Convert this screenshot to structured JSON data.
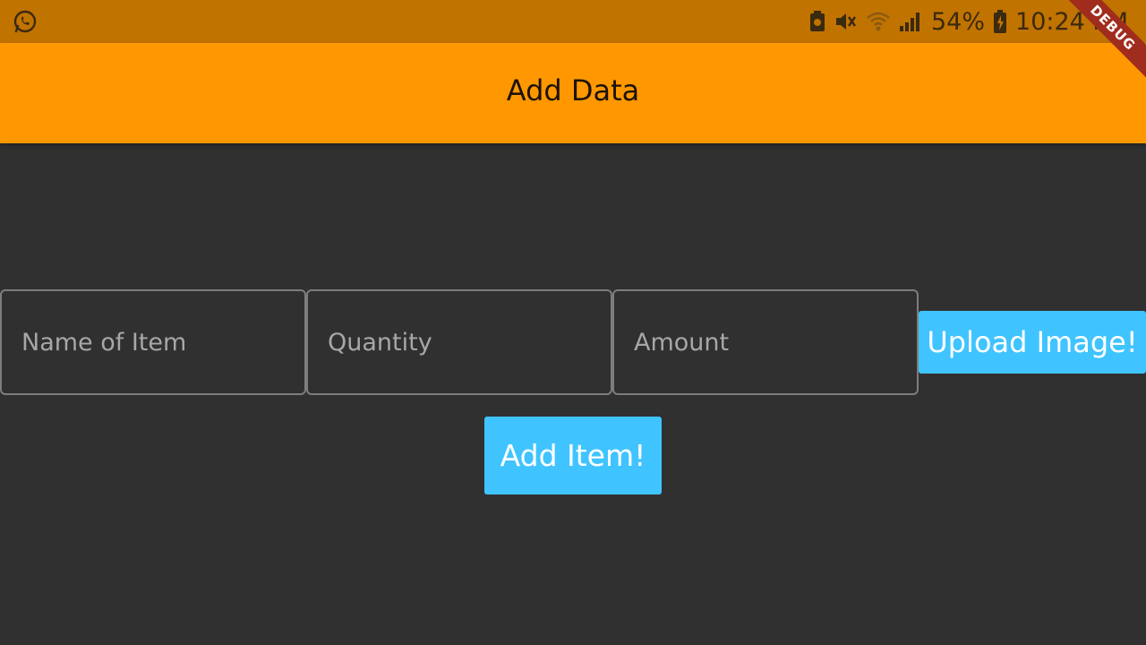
{
  "status_bar": {
    "left_icon": "whatsapp-icon",
    "icons": [
      "notification-icon",
      "mute-icon",
      "wifi-icon",
      "signal-icon",
      "battery-charging-icon"
    ],
    "battery": "54%",
    "time": "10:24 PM"
  },
  "debug_banner": "DEBUG",
  "app_bar": {
    "title": "Add Data",
    "color": "#ff9800"
  },
  "form": {
    "name_placeholder": "Name of Item",
    "quantity_placeholder": "Quantity",
    "amount_placeholder": "Amount",
    "upload_label": "Upload Image!",
    "add_label": "Add Item!",
    "button_color": "#40c4ff"
  }
}
